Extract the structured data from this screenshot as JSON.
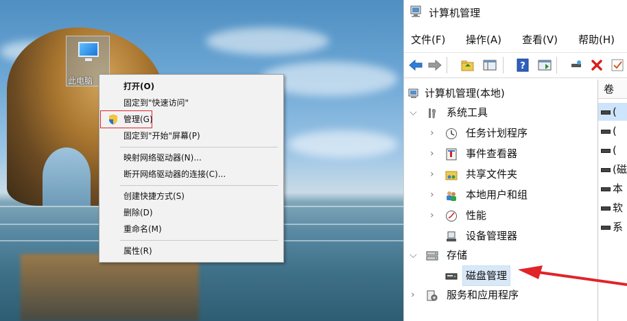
{
  "desktop": {
    "pc_icon_label": "此电脑",
    "context_menu": {
      "items": [
        {
          "label": "打开(O)",
          "bold": true
        },
        {
          "label": "固定到\"快速访问\""
        },
        {
          "label": "管理(G)",
          "highlighted": true,
          "icon": "uac-shield-icon"
        },
        {
          "label": "固定到\"开始\"屏幕(P)"
        },
        {
          "label": "映射网络驱动器(N)..."
        },
        {
          "label": "断开网络驱动器的连接(C)..."
        },
        {
          "label": "创建快捷方式(S)"
        },
        {
          "label": "删除(D)"
        },
        {
          "label": "重命名(M)"
        },
        {
          "label": "属性(R)"
        }
      ]
    }
  },
  "mmc": {
    "title": "计算机管理",
    "menu": [
      "文件(F)",
      "操作(A)",
      "查看(V)",
      "帮助(H)"
    ],
    "toolbar_icons": [
      "back-arrow-icon",
      "forward-arrow-icon",
      "up-folder-icon",
      "show-hide-tree-icon",
      "help-icon",
      "properties-icon",
      "connect-icon",
      "delete-icon",
      "check-icon"
    ],
    "tree": {
      "root": "计算机管理(本地)",
      "system_tools": "系统工具",
      "system_children": [
        "任务计划程序",
        "事件查看器",
        "共享文件夹",
        "本地用户和组",
        "性能",
        "设备管理器"
      ],
      "storage": "存储",
      "disk_management": "磁盘管理",
      "services": "服务和应用程序"
    },
    "right_pane": {
      "column_header": "卷",
      "rows": [
        "(",
        "(",
        "(",
        "(磁",
        "本",
        "软",
        "系"
      ]
    }
  },
  "colors": {
    "highlight_box": "#e0242a",
    "arrow": "#e0242a",
    "selection": "#d9e8f7"
  }
}
